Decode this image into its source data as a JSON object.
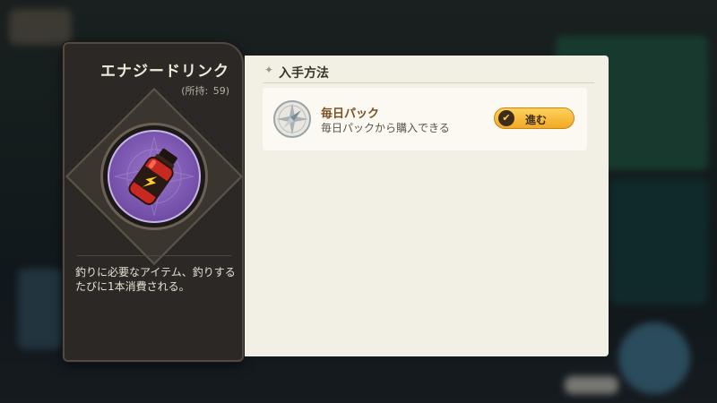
{
  "item": {
    "name": "エナジードリンク",
    "owned_label": "(所持:",
    "owned_count": "59)",
    "description": "釣りに必要なアイテム、釣りするたびに1本消費される。",
    "icon": "energy-drink-bottle-icon"
  },
  "acquisition": {
    "title": "入手方法",
    "sources": [
      {
        "name": "毎日パック",
        "description": "毎日パックから購入できる",
        "button_label": "進む",
        "icon": "compass-icon"
      }
    ]
  },
  "colors": {
    "panel_bg": "#f2efe4",
    "card_bg": "#2b2825",
    "button": "#f0a925",
    "icon_bg": "#7b56b0"
  }
}
